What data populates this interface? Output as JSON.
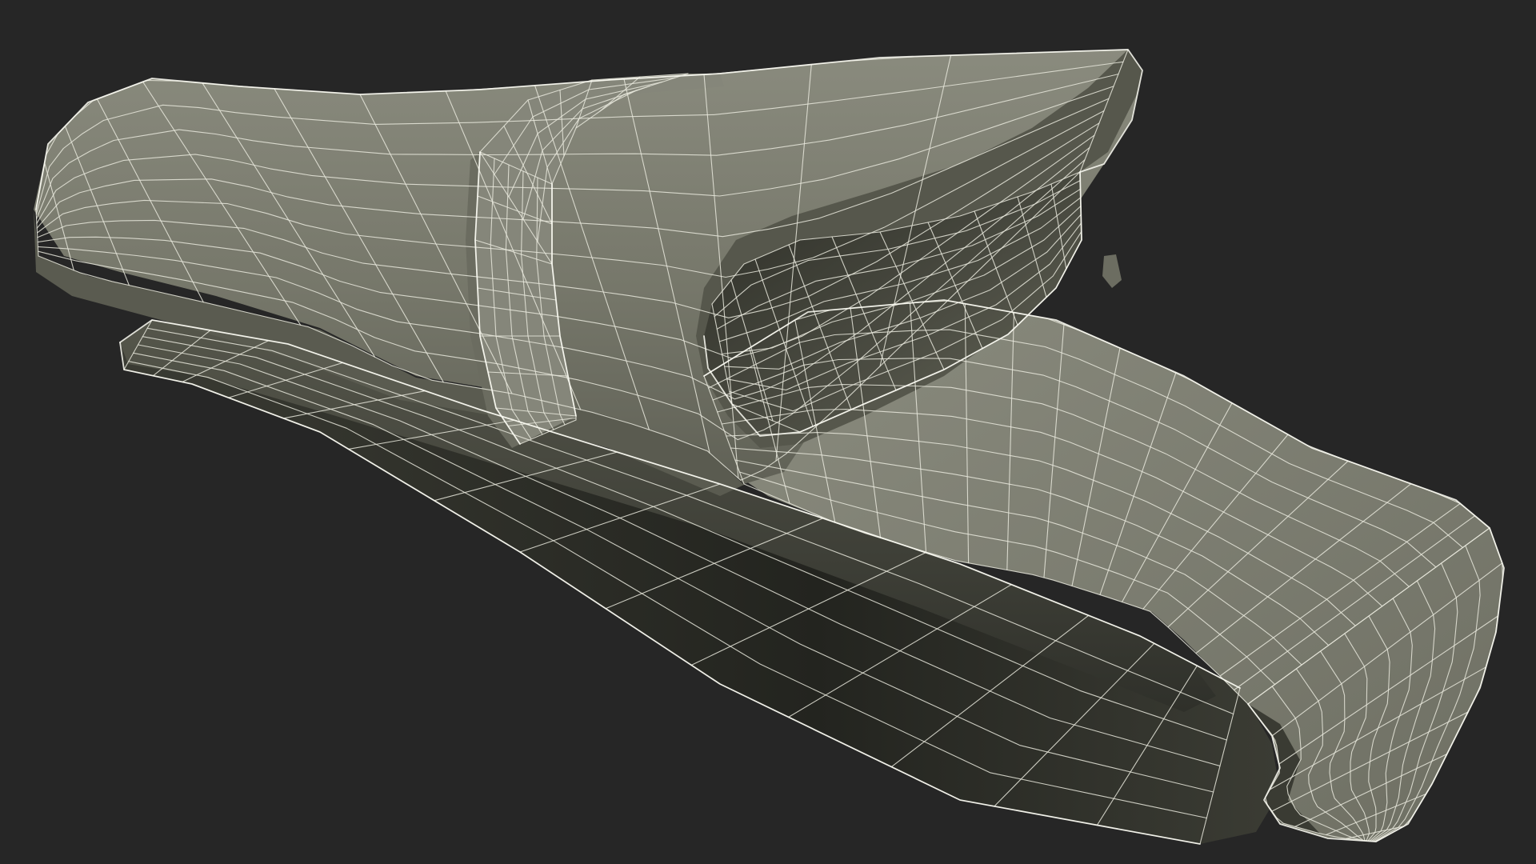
{
  "scene": {
    "subject": "wireframe-holster-model",
    "background_color": "#262626",
    "surface_color": "#7a7b6e",
    "surface_dark_color": "#5f6055",
    "interior_color": "#3c3d34",
    "wire_color": "#e8e8dc",
    "wire_bright_color": "#fbfbf3"
  }
}
